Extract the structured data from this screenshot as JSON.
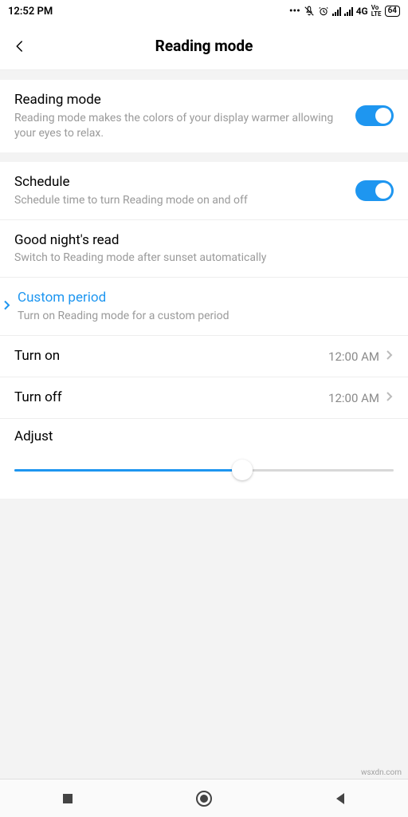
{
  "status": {
    "time": "12:52 PM",
    "network": "4G",
    "volte": "Vo LTE",
    "battery": "64"
  },
  "header": {
    "title": "Reading mode"
  },
  "reading_mode": {
    "title": "Reading mode",
    "desc": "Reading mode makes the colors of your display warmer allowing your eyes to relax.",
    "on": true
  },
  "schedule": {
    "title": "Schedule",
    "desc": "Schedule time to turn Reading mode on and off",
    "on": true,
    "good_night": {
      "title": "Good night's read",
      "desc": "Switch to Reading mode after sunset automatically"
    },
    "custom": {
      "title": "Custom period",
      "desc": "Turn on Reading mode for a custom period"
    },
    "turn_on": {
      "label": "Turn on",
      "value": "12:00 AM"
    },
    "turn_off": {
      "label": "Turn off",
      "value": "12:00 AM"
    }
  },
  "adjust": {
    "label": "Adjust",
    "value_percent": 60
  },
  "watermark": "wsxdn.com"
}
